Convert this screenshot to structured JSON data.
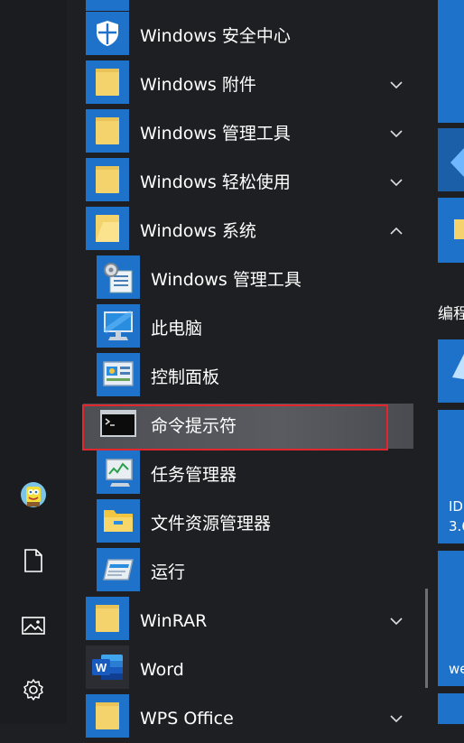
{
  "left_rail": {
    "icons": [
      "user-avatar",
      "document-icon",
      "pictures-icon",
      "settings-gear-icon"
    ]
  },
  "app_list": {
    "items": [
      {
        "label": "Windows 安全中心",
        "icon": "shield-icon",
        "expandable": false
      },
      {
        "label": "Windows 附件",
        "icon": "folder-icon",
        "expandable": true,
        "expanded": false
      },
      {
        "label": "Windows 管理工具",
        "icon": "folder-icon",
        "expandable": true,
        "expanded": false
      },
      {
        "label": "Windows 轻松使用",
        "icon": "folder-icon",
        "expandable": true,
        "expanded": false
      },
      {
        "label": "Windows 系统",
        "icon": "folder-icon",
        "expandable": true,
        "expanded": true
      },
      {
        "label": "Windows 管理工具",
        "icon": "admin-tools-icon",
        "indent": true
      },
      {
        "label": "此电脑",
        "icon": "computer-icon",
        "indent": true
      },
      {
        "label": "控制面板",
        "icon": "control-panel-icon",
        "indent": true
      },
      {
        "label": "命令提示符",
        "icon": "command-prompt-icon",
        "indent": true,
        "highlighted": true
      },
      {
        "label": "任务管理器",
        "icon": "task-manager-icon",
        "indent": true
      },
      {
        "label": "文件资源管理器",
        "icon": "file-explorer-icon",
        "indent": true
      },
      {
        "label": "运行",
        "icon": "run-icon",
        "indent": true
      },
      {
        "label": "WinRAR",
        "icon": "folder-icon",
        "expandable": true,
        "expanded": false
      },
      {
        "label": "Word",
        "icon": "word-icon",
        "expandable": false
      },
      {
        "label": "WPS Office",
        "icon": "folder-icon",
        "expandable": true,
        "expanded": false
      }
    ]
  },
  "tiles": {
    "group_label": "编程",
    "tile_text_1": "ID",
    "tile_text_2": "3.6",
    "tile_text_3": "we"
  },
  "colors": {
    "accent": "#1e72c9",
    "highlight_border": "#e1262d",
    "background": "#1e1f23"
  }
}
